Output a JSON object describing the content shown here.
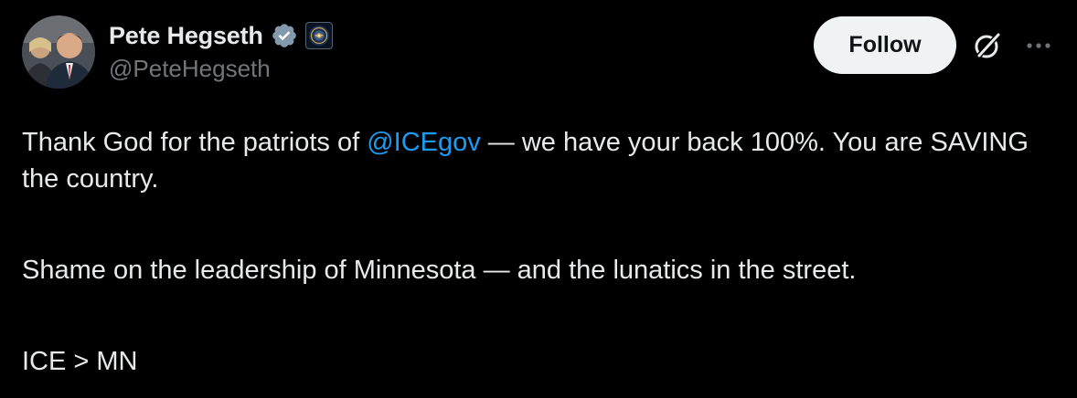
{
  "author": {
    "display_name": "Pete Hegseth",
    "handle": "@PeteHegseth",
    "verified_icon": "verified-badge-icon",
    "affiliation_icon": "department-seal-icon"
  },
  "actions": {
    "follow_label": "Follow",
    "grok_icon": "grok-icon",
    "more_icon": "more-icon"
  },
  "tweet": {
    "line1_before": "Thank God for the patriots of ",
    "mention": "@ICEgov",
    "line1_after": " — we have your back 100%. You are SAVING the country.",
    "paragraph2": "Shame on the leadership of Minnesota — and the lunatics in the street.",
    "paragraph3": "ICE > MN"
  },
  "colors": {
    "background": "#000000",
    "text": "#e7e9ea",
    "secondary": "#71767b",
    "link": "#1d9bf0",
    "verified": "#829aab",
    "follow_bg": "#eff3f4"
  }
}
